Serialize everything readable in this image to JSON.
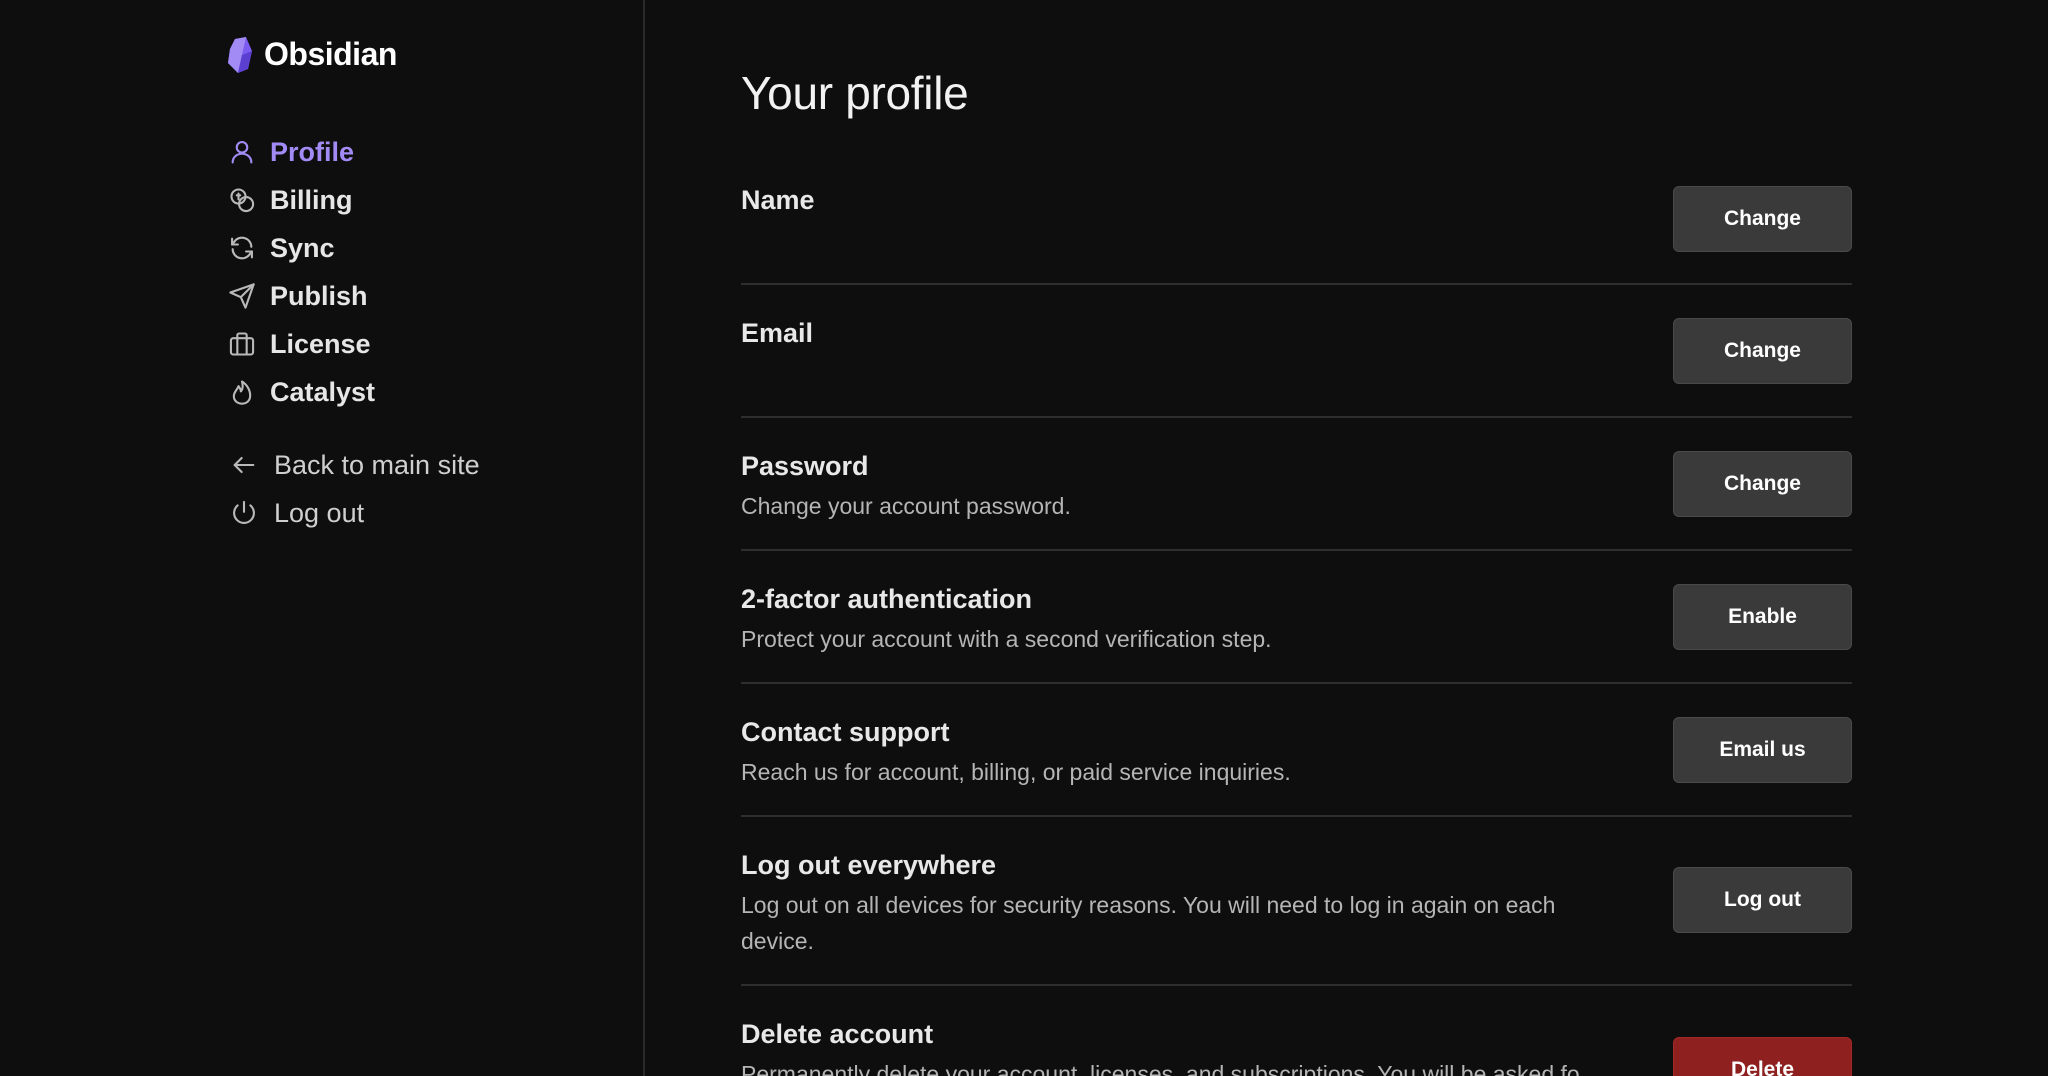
{
  "brand": {
    "name": "Obsidian",
    "accent": "#a38bf5"
  },
  "nav": {
    "items": [
      {
        "label": "Profile",
        "icon": "user-icon",
        "active": true
      },
      {
        "label": "Billing",
        "icon": "coins-icon"
      },
      {
        "label": "Sync",
        "icon": "refresh-icon"
      },
      {
        "label": "Publish",
        "icon": "send-icon"
      },
      {
        "label": "License",
        "icon": "briefcase-icon"
      },
      {
        "label": "Catalyst",
        "icon": "flame-icon"
      }
    ],
    "secondary": [
      {
        "label": "Back to main site",
        "icon": "arrow-left-icon"
      },
      {
        "label": "Log out",
        "icon": "power-icon"
      }
    ]
  },
  "main": {
    "title": "Your profile",
    "settings": [
      {
        "title": "Name",
        "description": "",
        "button": "Change"
      },
      {
        "title": "Email",
        "description": "",
        "button": "Change"
      },
      {
        "title": "Password",
        "description": "Change your account password.",
        "button": "Change"
      },
      {
        "title": "2-factor authentication",
        "description": "Protect your account with a second verification step.",
        "button": "Enable"
      },
      {
        "title": "Contact support",
        "description": "Reach us for account, billing, or paid service inquiries.",
        "button": "Email us"
      },
      {
        "title": "Log out everywhere",
        "description": "Log out on all devices for security reasons. You will need to log in again on each device.",
        "button": "Log out"
      },
      {
        "title": "Delete account",
        "description": "Permanently delete your account, licenses, and subscriptions. You will be asked for",
        "button": "Delete",
        "danger_color": "#8e2120"
      }
    ]
  }
}
